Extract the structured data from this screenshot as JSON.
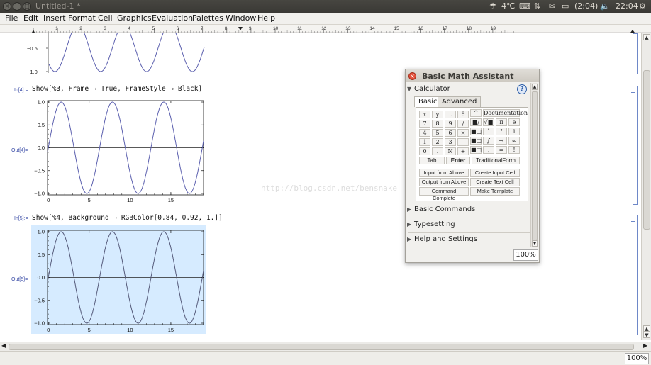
{
  "titlebar": {
    "title": "Untitled-1 *",
    "close": "×",
    "minimize": "−",
    "maximize": "□",
    "temperature": "4℃",
    "battery": "(2:04)",
    "clock": "22:04",
    "settings_glyph": "⚙"
  },
  "menu": [
    "File",
    "Edit",
    "Insert",
    "Format",
    "Cell",
    "Graphics",
    "Evaluation",
    "Palettes",
    "Window",
    "Help"
  ],
  "ruler": {
    "labels": [
      "1",
      "2",
      "3",
      "4",
      "5",
      "6",
      "7",
      "8",
      "9",
      "10",
      "11",
      "12",
      "13",
      "14",
      "15",
      "16",
      "17",
      "18",
      "19"
    ]
  },
  "notebook": {
    "cells": [
      {
        "in_label": "In[4]:=",
        "input": "Show[%3, Frame → True, FrameStyle → Black]",
        "out_label": "Out[4]="
      },
      {
        "in_label": "In[5]:=",
        "input": "Show[%4, Background → RGBColor[0.84, 0.92, 1.]]",
        "out_label": "Out[5]="
      }
    ],
    "partial_plot_ticks": [
      "−0.5",
      "−1.0"
    ],
    "y_ticks": [
      "1.0",
      "0.5",
      "0.0",
      "−0.5",
      "−1.0"
    ],
    "x_ticks": [
      "0",
      "5",
      "10",
      "15"
    ],
    "plot_line_color": "#5b5fae",
    "plot_line_color_dark": "#555a7a",
    "background_color": "#d6ebff"
  },
  "watermark": "http://blog.csdn.net/bensnake",
  "palette": {
    "title": "Basic Math Assistant",
    "help": "?",
    "calculator": "Calculator",
    "tabs": [
      "Basic",
      "Advanced"
    ],
    "keys": [
      [
        "x",
        "y",
        "t",
        "θ",
        "^"
      ],
      [
        "7",
        "8",
        "9",
        "/",
        "√■"
      ],
      [
        "4",
        "5",
        "6",
        "×",
        "■"
      ],
      [
        "1",
        "2",
        "3",
        "−",
        "■"
      ],
      [
        "0",
        ".",
        "N",
        "+",
        "■"
      ]
    ],
    "side_keys": [
      [
        "π",
        "e"
      ],
      [
        "°",
        "i"
      ],
      [
        "→",
        "∞"
      ],
      [
        "=",
        "!"
      ]
    ],
    "mid_keys": [
      "˄",
      "∫",
      ",",
      ""
    ],
    "documentation": "Documentation",
    "tab_key": "Tab",
    "enter_key": "Enter",
    "traditional_form": "TraditionalForm",
    "wide_buttons": [
      [
        "Input from Above",
        "Create Input Cell"
      ],
      [
        "Output from Above",
        "Create Text Cell"
      ],
      [
        "Command Complete",
        "Make Template"
      ]
    ],
    "sections": [
      "Basic Commands",
      "Typesetting",
      "Help and Settings"
    ],
    "zoom": "100%"
  },
  "status": {
    "zoom": "100%"
  }
}
